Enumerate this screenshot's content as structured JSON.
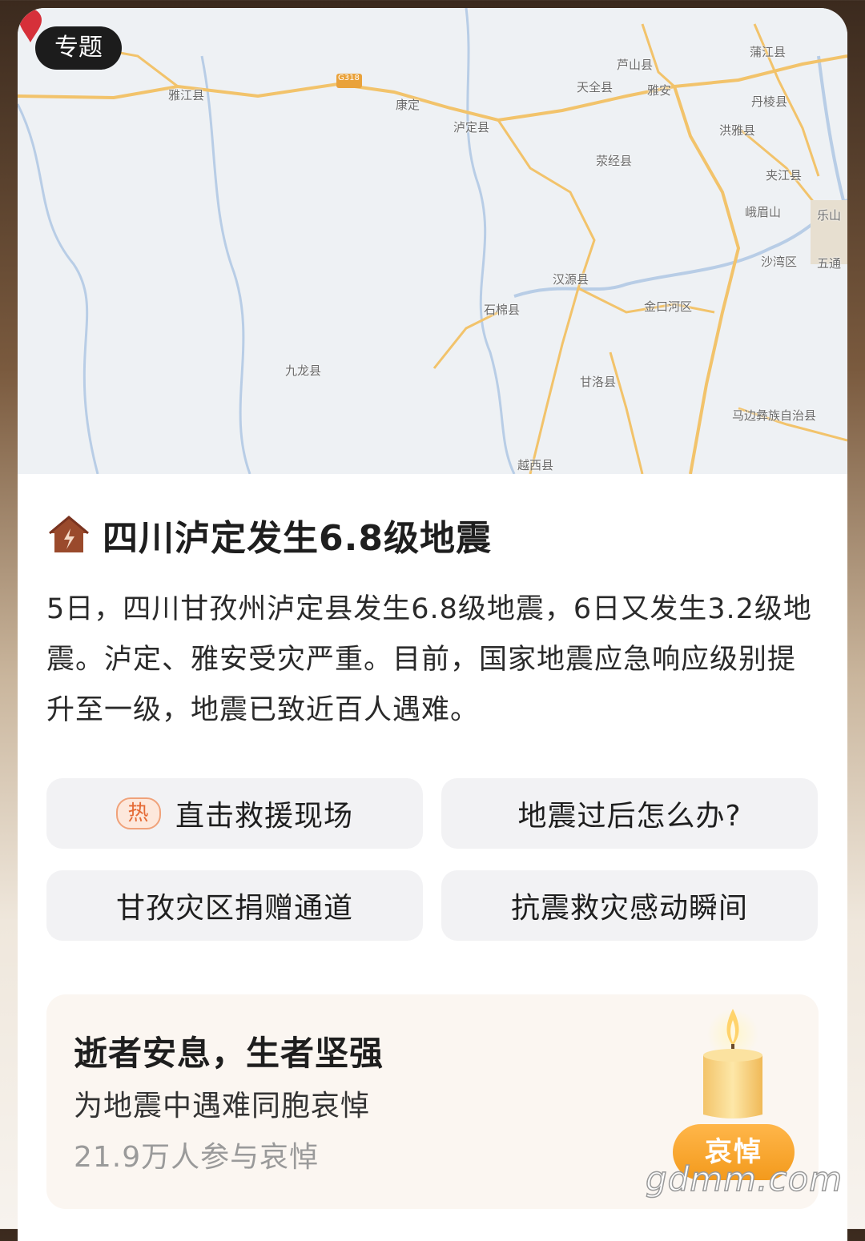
{
  "topic_tag": "专题",
  "map": {
    "labels": [
      "雅江县",
      "康定",
      "泸定县",
      "天全县",
      "芦山县",
      "雅安",
      "蒲江县",
      "丹棱县",
      "洪雅县",
      "荥经县",
      "夹江县",
      "峨眉山",
      "乐山",
      "沙湾区",
      "五通",
      "汉源县",
      "石棉县",
      "金口河区",
      "九龙县",
      "甘洛县",
      "马边彝族自治县",
      "越西县",
      "G318"
    ]
  },
  "article": {
    "title": "四川泸定发生6.8级地震",
    "description": "5日，四川甘孜州泸定县发生6.8级地震，6日又发生3.2级地震。泸定、雅安受灾严重。目前，国家地震应急响应级别提升至一级，地震已致近百人遇难。"
  },
  "links": {
    "hot_badge": "热",
    "rescue": "直击救援现场",
    "after_quake": "地震过后怎么办?",
    "donation": "甘孜灾区捐赠通道",
    "moments": "抗震救灾感动瞬间"
  },
  "mourning": {
    "title": "逝者安息，生者坚强",
    "subtitle": "为地震中遇难同胞哀悼",
    "count": "21.9万人参与哀悼",
    "button": "哀悼"
  },
  "watermark": "gdmm.com"
}
